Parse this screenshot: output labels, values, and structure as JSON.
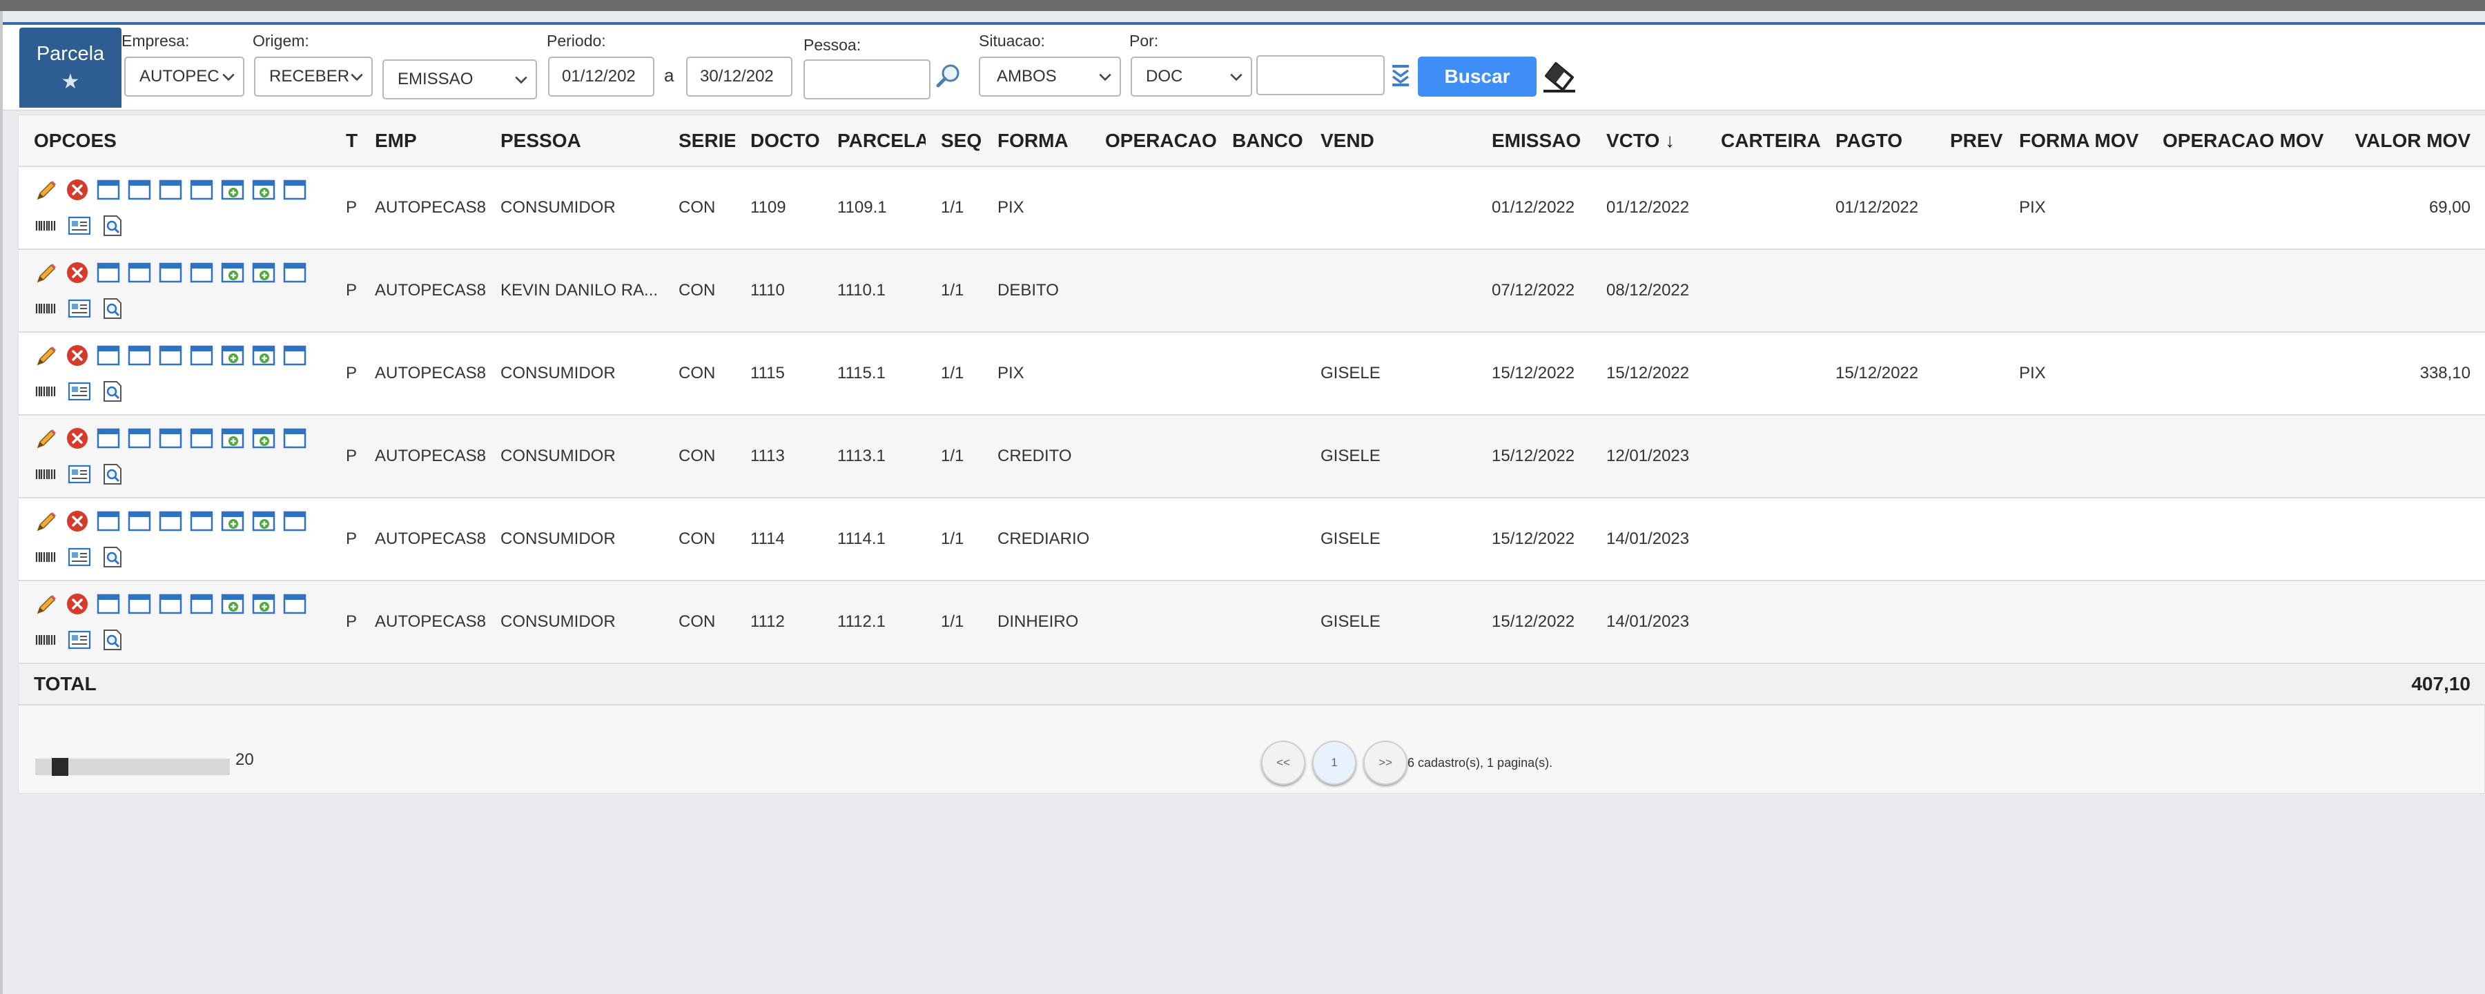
{
  "module": {
    "title": "Parcela",
    "star_icon": "star-icon"
  },
  "filters": {
    "empresa": {
      "label": "Empresa:",
      "value": "AUTOPEC"
    },
    "origem": {
      "label": "Origem:",
      "value": "RECEBER"
    },
    "data_tipo": {
      "value": "EMISSAO"
    },
    "periodo": {
      "label": "Periodo:",
      "from": "01/12/202",
      "separator": "a",
      "to": "30/12/202"
    },
    "pessoa": {
      "label": "Pessoa:",
      "value": ""
    },
    "situacao": {
      "label": "Situacao:",
      "value": "AMBOS"
    },
    "por": {
      "label": "Por:",
      "value": "DOC",
      "extra_value": ""
    },
    "search_label": "Buscar"
  },
  "table": {
    "columns": [
      "OPCOES",
      "T",
      "EMP",
      "PESSOA",
      "SERIE",
      "DOCTO",
      "PARCELA",
      "SEQ",
      "FORMA",
      "OPERACAO",
      "BANCO",
      "VEND",
      "EMISSAO",
      "VCTO",
      "CARTEIRA",
      "PAGTO",
      "PREV",
      "FORMA MOV",
      "OPERACAO MOV",
      "VALOR MOV"
    ],
    "sort_column": "VCTO",
    "sort_arrow": "↓",
    "rows": [
      {
        "t": "P",
        "emp": "AUTOPECAS8",
        "pessoa": "CONSUMIDOR",
        "serie": "CON",
        "docto": "1109",
        "parcela": "1109.1",
        "seq": "1/1",
        "forma": "PIX",
        "operacao": "",
        "banco": "",
        "vend": "",
        "emissao": "01/12/2022",
        "vcto": "01/12/2022",
        "carteira": "",
        "pagto": "01/12/2022",
        "prev": "",
        "forma_mov": "PIX",
        "operacao_mov": "",
        "valor_mov": "69,00"
      },
      {
        "t": "P",
        "emp": "AUTOPECAS8",
        "pessoa": "KEVIN DANILO RA...",
        "serie": "CON",
        "docto": "1110",
        "parcela": "1110.1",
        "seq": "1/1",
        "forma": "DEBITO",
        "operacao": "",
        "banco": "",
        "vend": "",
        "emissao": "07/12/2022",
        "vcto": "08/12/2022",
        "carteira": "",
        "pagto": "",
        "prev": "",
        "forma_mov": "",
        "operacao_mov": "",
        "valor_mov": ""
      },
      {
        "t": "P",
        "emp": "AUTOPECAS8",
        "pessoa": "CONSUMIDOR",
        "serie": "CON",
        "docto": "1115",
        "parcela": "1115.1",
        "seq": "1/1",
        "forma": "PIX",
        "operacao": "",
        "banco": "",
        "vend": "GISELE",
        "emissao": "15/12/2022",
        "vcto": "15/12/2022",
        "carteira": "",
        "pagto": "15/12/2022",
        "prev": "",
        "forma_mov": "PIX",
        "operacao_mov": "",
        "valor_mov": "338,10"
      },
      {
        "t": "P",
        "emp": "AUTOPECAS8",
        "pessoa": "CONSUMIDOR",
        "serie": "CON",
        "docto": "1113",
        "parcela": "1113.1",
        "seq": "1/1",
        "forma": "CREDITO",
        "operacao": "",
        "banco": "",
        "vend": "GISELE",
        "emissao": "15/12/2022",
        "vcto": "12/01/2023",
        "carteira": "",
        "pagto": "",
        "prev": "",
        "forma_mov": "",
        "operacao_mov": "",
        "valor_mov": ""
      },
      {
        "t": "P",
        "emp": "AUTOPECAS8",
        "pessoa": "CONSUMIDOR",
        "serie": "CON",
        "docto": "1114",
        "parcela": "1114.1",
        "seq": "1/1",
        "forma": "CREDIARIO",
        "operacao": "",
        "banco": "",
        "vend": "GISELE",
        "emissao": "15/12/2022",
        "vcto": "14/01/2023",
        "carteira": "",
        "pagto": "",
        "prev": "",
        "forma_mov": "",
        "operacao_mov": "",
        "valor_mov": ""
      },
      {
        "t": "P",
        "emp": "AUTOPECAS8",
        "pessoa": "CONSUMIDOR",
        "serie": "CON",
        "docto": "1112",
        "parcela": "1112.1",
        "seq": "1/1",
        "forma": "DINHEIRO",
        "operacao": "",
        "banco": "",
        "vend": "GISELE",
        "emissao": "15/12/2022",
        "vcto": "14/01/2023",
        "carteira": "",
        "pagto": "",
        "prev": "",
        "forma_mov": "",
        "operacao_mov": "",
        "valor_mov": ""
      }
    ],
    "total_label": "TOTAL",
    "total_value": "407,10",
    "row_icons": [
      "edit-pencil-icon",
      "delete-icon",
      "window-icon",
      "window-icon",
      "window-icon",
      "window-icon",
      "window-add-icon",
      "window-add-icon",
      "window-icon",
      "barcode-icon",
      "card-icon",
      "document-search-icon"
    ]
  },
  "pagination": {
    "page_size": "20",
    "prev_label": "<<",
    "current_page": "1",
    "next_label": ">>",
    "info": "6 cadastro(s), 1 pagina(s)."
  },
  "colors": {
    "accent": "#2e5d94",
    "button": "#3f8ef7",
    "delete": "#d63a2a"
  }
}
